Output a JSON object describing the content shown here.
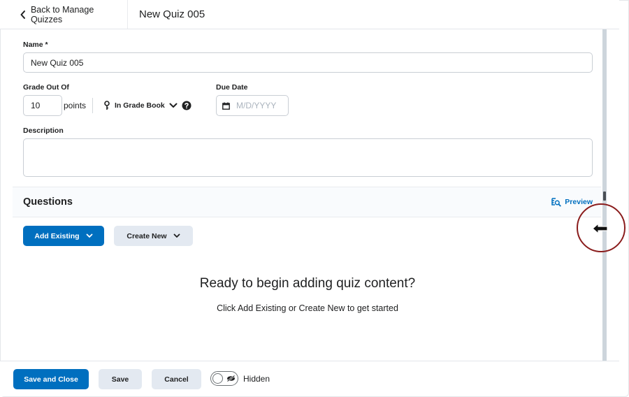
{
  "header": {
    "back_label": "Back to Manage Quizzes",
    "page_title": "New Quiz 005"
  },
  "form": {
    "name_label": "Name *",
    "name_value": "New Quiz 005",
    "grade_label": "Grade Out Of",
    "grade_value": "10",
    "points_label": "points",
    "gradebook_label": "In Grade Book",
    "due_date_label": "Due Date",
    "due_date_placeholder": "M/D/YYYY",
    "description_label": "Description",
    "description_value": ""
  },
  "questions": {
    "title": "Questions",
    "preview_label": "Preview",
    "add_existing_label": "Add Existing",
    "create_new_label": "Create New",
    "empty_title": "Ready to begin adding quiz content?",
    "empty_subtitle": "Click Add Existing or Create New to get started"
  },
  "footer": {
    "save_close_label": "Save and Close",
    "save_label": "Save",
    "cancel_label": "Cancel",
    "visibility_label": "Hidden",
    "visibility_on": false
  },
  "colors": {
    "primary": "#006fbf",
    "secondary_button": "#e3e9f1",
    "link": "#006fbf",
    "callout": "#8a1c1c"
  },
  "icons": {
    "back": "chevron-left-icon",
    "gradebook": "pin-icon",
    "gradebook_dropdown": "chevron-down-icon",
    "help": "help-circle-icon",
    "date": "calendar-icon",
    "preview": "preview-search-icon",
    "visibility": "eye-hidden-icon",
    "callout_arrow": "arrow-left-icon"
  }
}
